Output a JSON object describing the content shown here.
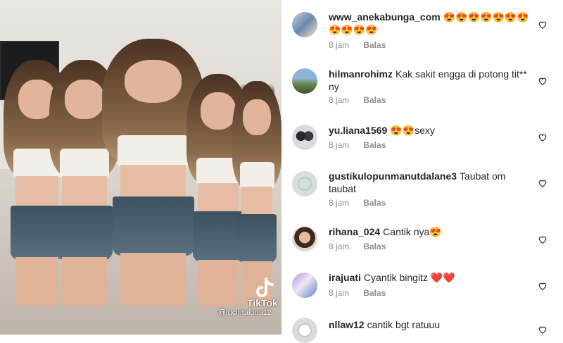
{
  "media": {
    "watermark_brand": "TikTok",
    "watermark_user": "@lucintaluna12"
  },
  "comments": [
    {
      "username": "www_anekabunga_com",
      "text": "😍😍😍😍😍😍😍😍😍😍😍",
      "time": "8 jam",
      "reply_label": "Balas"
    },
    {
      "username": "hilmanrohimz",
      "text": "Kak sakit engga di potong tit** ny",
      "time": "8 jam",
      "reply_label": "Balas"
    },
    {
      "username": "yu.liana1569",
      "text": "😍😍sexy",
      "time": "8 jam",
      "reply_label": "Balas"
    },
    {
      "username": "gustikulopunmanutdalane3",
      "text": "Taubat om taubat",
      "time": "8 jam",
      "reply_label": "Balas"
    },
    {
      "username": "rihana_024",
      "text": "Cantik nya😍",
      "time": "8 jam",
      "reply_label": "Balas"
    },
    {
      "username": "irajuati",
      "text": "Cyantik bingitz ❤️❤️",
      "time": "8 jam",
      "reply_label": "Balas"
    },
    {
      "username": "nllaw12",
      "text": "cantik bgt ratuuu",
      "time": "",
      "reply_label": ""
    }
  ],
  "icons": {
    "like": "heart-outline-icon"
  },
  "colors": {
    "text": "#262626",
    "meta": "#8e8e8e"
  }
}
